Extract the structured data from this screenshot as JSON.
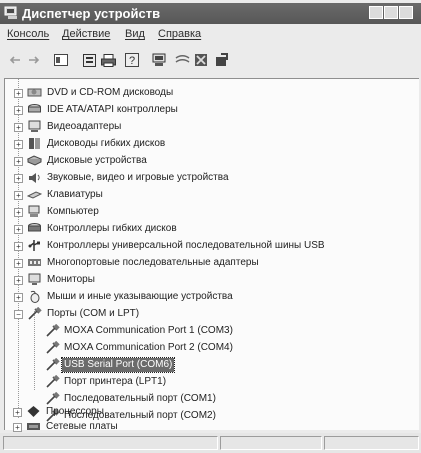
{
  "window": {
    "title": "Диспетчер устройств"
  },
  "menu": [
    "Консоль",
    "Действие",
    "Вид",
    "Справка"
  ],
  "toolbar": {
    "icons": [
      "back-arrow-icon",
      "forward-arrow-icon",
      "console-tree-icon",
      "properties-icon",
      "print-icon",
      "help-icon",
      "scan-hardware-icon",
      "disable-device-icon",
      "uninstall-device-icon",
      "update-driver-icon"
    ]
  },
  "tree": {
    "items": [
      {
        "label": "DVD и CD-ROM дисководы",
        "icon": "cdrom-icon"
      },
      {
        "label": "IDE ATA/ATAPI контроллеры",
        "icon": "ide-controller-icon"
      },
      {
        "label": "Видеоадаптеры",
        "icon": "display-adapter-icon"
      },
      {
        "label": "Дисководы гибких дисков",
        "icon": "floppy-drive-icon"
      },
      {
        "label": "Дисковые устройства",
        "icon": "disk-drive-icon"
      },
      {
        "label": "Звуковые, видео и игровые устройства",
        "icon": "sound-icon"
      },
      {
        "label": "Клавиатуры",
        "icon": "keyboard-icon"
      },
      {
        "label": "Компьютер",
        "icon": "computer-icon"
      },
      {
        "label": "Контроллеры гибких дисков",
        "icon": "floppy-controller-icon"
      },
      {
        "label": "Контроллеры универсальной последовательной шины USB",
        "icon": "usb-controller-icon"
      },
      {
        "label": "Многопортовые последовательные адаптеры",
        "icon": "multiport-adapter-icon"
      },
      {
        "label": "Мониторы",
        "icon": "monitor-icon"
      },
      {
        "label": "Мыши и иные указывающие устройства",
        "icon": "mouse-icon"
      },
      {
        "label": "Порты (COM и LPT)",
        "icon": "port-icon"
      }
    ],
    "ports_children": [
      {
        "label": "MOXA Communication Port 1 (COM3)"
      },
      {
        "label": "MOXA Communication Port 2 (COM4)"
      },
      {
        "label": "USB Serial Port (COM6)",
        "selected": true
      },
      {
        "label": "Порт принтера (LPT1)"
      },
      {
        "label": "Последовательный порт (COM1)"
      },
      {
        "label": "Последовательный порт (COM2)"
      }
    ],
    "after": [
      {
        "label": "Процессоры",
        "icon": "processor-icon"
      },
      {
        "label": "Сетевые платы",
        "icon": "network-adapter-icon"
      }
    ]
  }
}
